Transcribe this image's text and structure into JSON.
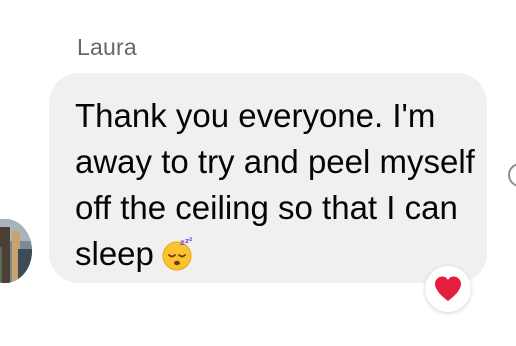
{
  "message": {
    "sender": "Laura",
    "text": "Thank you everyone. I'm away to try and peel myself off the ceiling so that I can sleep",
    "emoji": "sleeping-face"
  },
  "reaction": {
    "icon": "heart-icon",
    "color": "#e41e3f"
  },
  "colors": {
    "bubble": "#f0f0f0",
    "sender_name": "#65676b",
    "text": "#050505"
  }
}
